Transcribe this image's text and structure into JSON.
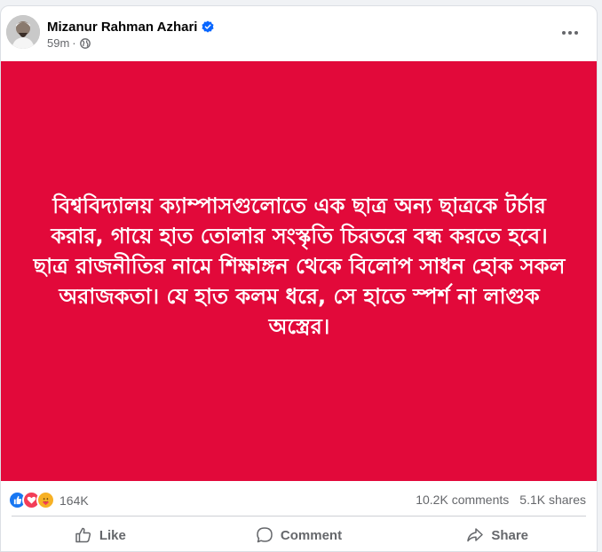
{
  "author": {
    "name": "Mizanur Rahman Azhari",
    "time": "59m"
  },
  "post": {
    "text": "বিশ্ববিদ্যালয় ক্যাম্পাসগুলোতে এক ছাত্র অন্য ছাত্রকে টর্চার করার, গায়ে হাত তোলার সংস্কৃতি চিরতরে বন্ধ করতে হবে। ছাত্র রাজনীতির নামে শিক্ষাঙ্গন থেকে বিলোপ সাধন হোক সকল অরাজকতা। যে হাত কলম ধরে, সে হাতে স্পর্শ না লাগুক অস্ত্রের।",
    "background_color": "#e2093a"
  },
  "stats": {
    "reactions_count": "164K",
    "comments": "10.2K comments",
    "shares": "5.1K shares"
  },
  "actions": {
    "like": "Like",
    "comment": "Comment",
    "share": "Share"
  },
  "icons": {
    "verified": "verified-badge-icon",
    "privacy": "globe-icon",
    "more": "more-horizontal-icon",
    "reactions": [
      "like-reaction-icon",
      "love-reaction-icon",
      "care-reaction-icon"
    ]
  },
  "colors": {
    "verified_blue": "#0866ff",
    "text_secondary": "#65676b"
  }
}
